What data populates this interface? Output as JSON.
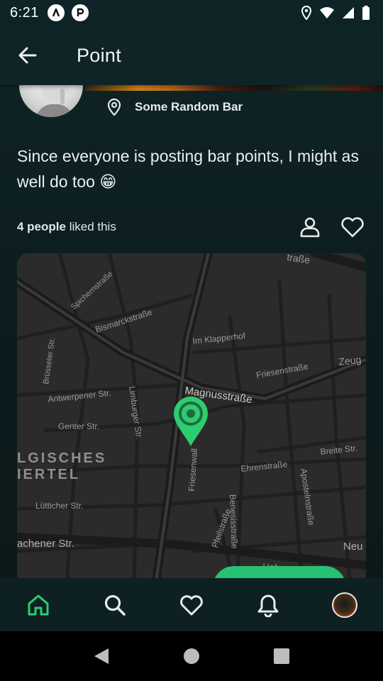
{
  "status_bar": {
    "time": "6:21"
  },
  "app_bar": {
    "title": "Point"
  },
  "post": {
    "location": "Some Random Bar",
    "text": "Since everyone is posting bar points, I might as well do too 😁",
    "likes_count": "4 people",
    "likes_suffix": " liked this"
  },
  "map": {
    "labels": {
      "strasse_top": "traße",
      "spichernstrasse": "Spichernstraße",
      "bismarckstrasse": "Bismarckstraße",
      "im_klapperhof": "Im Klapperhof",
      "friesenstrasse": "Friesenstraße",
      "zeug": "Zeug",
      "brusseler_str": "Brüsseler Str.",
      "antwerpener_str": "Antwerpener Str.",
      "limburger_str": "Limburger Str.",
      "magnusstrasse": "Magnusstraße",
      "genter_str": "Genter Str.",
      "breite_str": "Breite Str.",
      "belgisches": "LGISCHES",
      "viertel": "IERTEL",
      "friesenwall": "Friesenwall",
      "ehrenstrasse": "Ehrenstraße",
      "apostelnstrasse": "Apostelnstraße",
      "lutticher_str": "Lütticher Str.",
      "pfeilstrasse": "Pfeilstraße",
      "benesisstrasse": "Benesisstraße",
      "achener_str": "achener Str.",
      "hohenstrasse": "Hohenstraße",
      "neu": "Neu"
    },
    "pin_color": "#2ecc71"
  },
  "colors": {
    "accent": "#27c174",
    "background": "#0f2426"
  },
  "icons": {
    "back": "arrow-left-icon",
    "location": "location-pin-icon",
    "person": "person-icon",
    "heart": "heart-outline-icon",
    "home": "home-icon",
    "search": "search-icon",
    "bell": "bell-icon"
  }
}
